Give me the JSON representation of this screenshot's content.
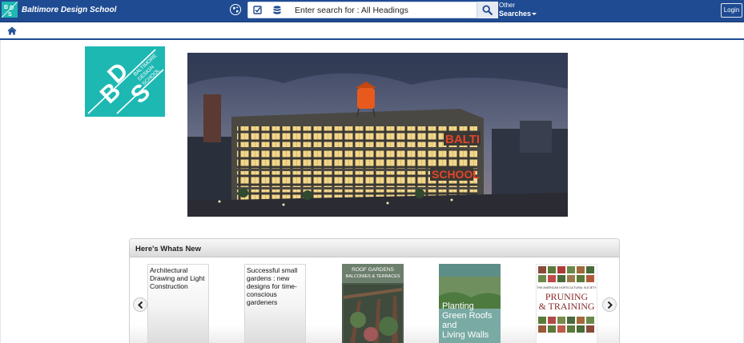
{
  "header": {
    "school_name": "Baltimore Design School",
    "search_placeholder": "Enter search for : All Headings",
    "other_label_top": "Other",
    "other_label_bottom": "Searches",
    "login_label": "Login"
  },
  "logo": {
    "mark_b": "B",
    "mark_d": "D",
    "mark_s": "S",
    "text_lines": [
      "BALTIMORE",
      "DESIGN",
      "SCHOOL"
    ]
  },
  "hero": {
    "sign_top": "BALTI",
    "sign_bottom": "SCHOOL"
  },
  "new_items": {
    "title": "Here's Whats New",
    "items": [
      {
        "title": "Architectural Drawing and Light Construction"
      },
      {
        "title": "Successful small gardens : new designs for time-conscious gardeners"
      },
      {
        "cover_title_1": "ROOF GARDENS",
        "cover_title_2": "BALCONIES & TERRACES"
      },
      {
        "cover_line_1": "Planting",
        "cover_line_2": "Green Roofs",
        "cover_line_3": "and",
        "cover_line_4": "Living Walls"
      },
      {
        "cover_top": "THE AMERICAN HORTICULTURAL SOCIETY",
        "cover_line_1": "PRUNING",
        "cover_line_2": "& TRAINING"
      }
    ]
  },
  "colors": {
    "header_blue": "#1f4b92",
    "brand_teal": "#1eb8b3"
  },
  "icons": [
    "globe-icon",
    "checklist-icon",
    "database-icon",
    "search-icon",
    "home-icon",
    "chevron-left-icon",
    "chevron-right-icon"
  ]
}
